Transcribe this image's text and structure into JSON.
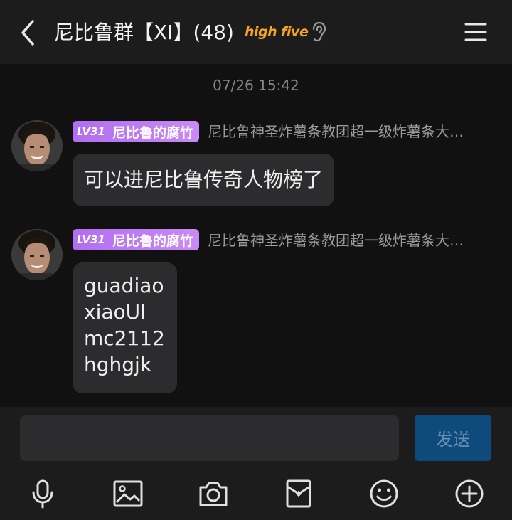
{
  "header": {
    "title": "尼比鲁群【XI】(48)",
    "badge_text": "high five",
    "icons": [
      "back-icon",
      "ear-icon",
      "menu-icon"
    ]
  },
  "timestamp": "07/26 15:42",
  "messages": [
    {
      "level": "LV31",
      "sender": "尼比鲁的腐竹",
      "title": "尼比鲁神圣炸薯条教团超一级炸薯条大…",
      "lines": [
        "可以进尼比鲁传奇人物榜了"
      ]
    },
    {
      "level": "LV31",
      "sender": "尼比鲁的腐竹",
      "title": "尼比鲁神圣炸薯条教团超一级炸薯条大…",
      "lines": [
        "guadiao",
        "xiaoUI",
        "mc2112",
        "hghgjk"
      ]
    }
  ],
  "composer": {
    "input_value": "",
    "send_label": "发送"
  },
  "toolbar": {
    "icons": [
      "microphone-icon",
      "image-icon",
      "camera-icon",
      "red-packet-icon",
      "emoji-icon",
      "plus-icon"
    ]
  },
  "colors": {
    "background": "#111111",
    "header": "#1c1c1c",
    "bubble": "#2c2c2e",
    "level_badge": "#b06ef0",
    "send_button": "#0f4a7c",
    "badge_orange": "#f7a51c"
  }
}
